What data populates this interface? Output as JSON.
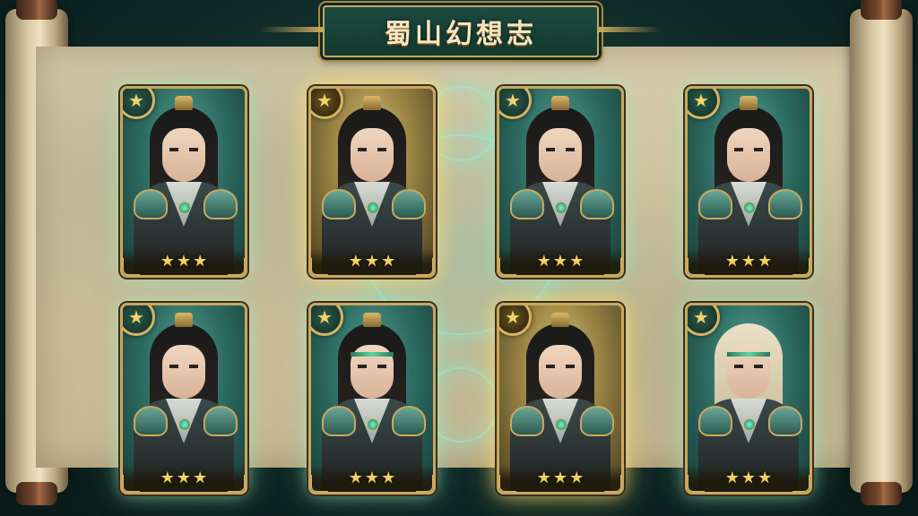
{
  "title": "蜀山幻想志",
  "cards": [
    {
      "rank_icon": "★",
      "stars": [
        "★",
        "★",
        "★"
      ],
      "theme": "teal",
      "hair": "dark"
    },
    {
      "rank_icon": "★",
      "stars": [
        "★",
        "★",
        "★"
      ],
      "theme": "gold",
      "hair": "dark"
    },
    {
      "rank_icon": "★",
      "stars": [
        "★",
        "★",
        "★"
      ],
      "theme": "teal",
      "hair": "dark"
    },
    {
      "rank_icon": "★",
      "stars": [
        "★",
        "★",
        "★"
      ],
      "theme": "teal",
      "hair": "dark"
    },
    {
      "rank_icon": "★",
      "stars": [
        "★",
        "★",
        "★"
      ],
      "theme": "teal",
      "hair": "dark"
    },
    {
      "rank_icon": "★",
      "stars": [
        "★",
        "★",
        "★"
      ],
      "theme": "teal",
      "hair": "dark"
    },
    {
      "rank_icon": "★",
      "stars": [
        "★",
        "★",
        "★"
      ],
      "theme": "gold",
      "hair": "dark"
    },
    {
      "rank_icon": "★",
      "stars": [
        "★",
        "★",
        "★"
      ],
      "theme": "teal",
      "hair": "light"
    }
  ],
  "colors": {
    "gold_trim": "#c8a860",
    "teal_bg": "#2f6e64",
    "gold_bg": "#9b8545",
    "star": "#f1cf63"
  }
}
